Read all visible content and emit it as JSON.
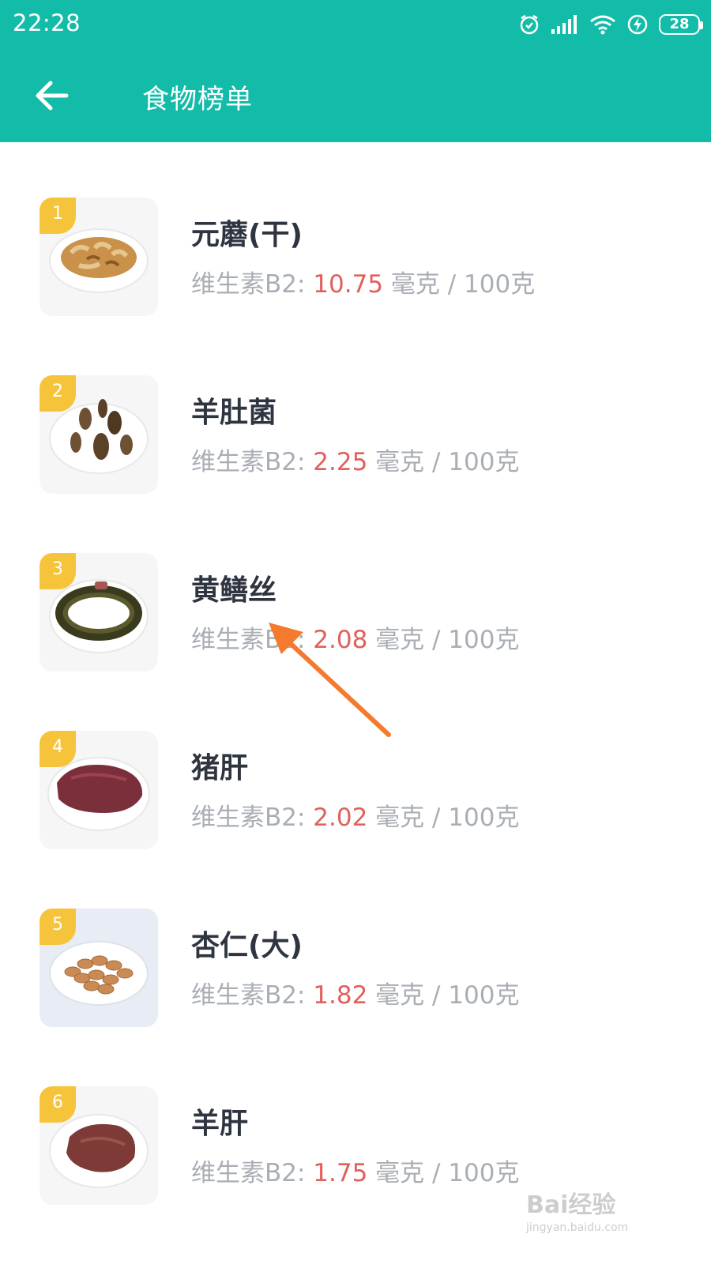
{
  "status_bar": {
    "time": "22:28",
    "battery": "28"
  },
  "app_bar": {
    "title": "食物榜单"
  },
  "nutrient_label": "维生素B2: ",
  "unit_label": " 毫克 / 100克",
  "items": [
    {
      "rank": "1",
      "name": "元蘑(干)",
      "value": "10.75",
      "image": "dried-mushroom-plate"
    },
    {
      "rank": "2",
      "name": "羊肚菌",
      "value": "2.25",
      "image": "morel-plate"
    },
    {
      "rank": "3",
      "name": "黄鳝丝",
      "value": "2.08",
      "image": "eel-plate"
    },
    {
      "rank": "4",
      "name": "猪肝",
      "value": "2.02",
      "image": "pork-liver-plate"
    },
    {
      "rank": "5",
      "name": "杏仁(大)",
      "value": "1.82",
      "image": "almonds-plate"
    },
    {
      "rank": "6",
      "name": "羊肝",
      "value": "1.75",
      "image": "lamb-liver-plate"
    }
  ],
  "watermark": {
    "brand": "Bai经验",
    "url": "jingyan.baidu.com"
  },
  "colors": {
    "accent": "#13bca8",
    "value": "#e0605c",
    "rank_badge": "#f6c43a",
    "arrow": "#f47a2e"
  }
}
